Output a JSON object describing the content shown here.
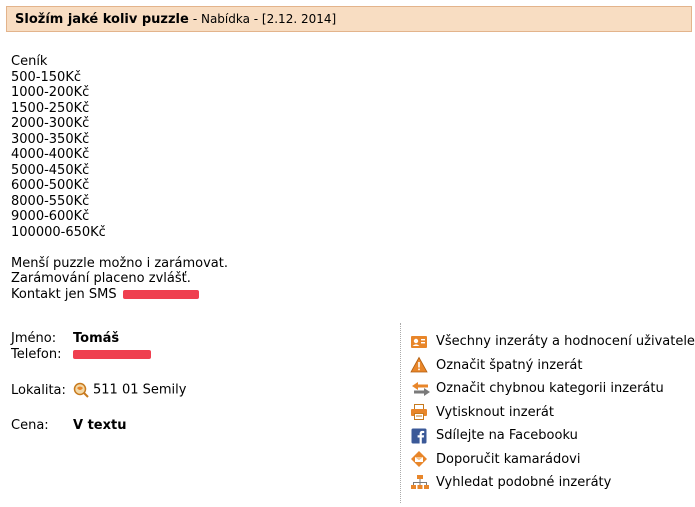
{
  "header": {
    "title": "Složím jaké koliv puzzle",
    "meta": "- Nabídka - [2.12. 2014]"
  },
  "description": {
    "pricelist_title": "Ceník",
    "prices": [
      "500-150Kč",
      "1000-200Kč",
      "1500-250Kč",
      "2000-300Kč",
      "3000-350Kč",
      "4000-400Kč",
      "5000-450Kč",
      "6000-500Kč",
      "8000-550Kč",
      "9000-600Kč",
      "100000-650Kč"
    ],
    "notes": [
      "Menší puzzle možno i zarámovat.",
      "Zarámování placeno zvlášť."
    ],
    "contact_label": "Kontakt jen SMS"
  },
  "seller": {
    "name_label": "Jméno:",
    "name_value": "Tomáš",
    "phone_label": "Telefon:",
    "location_label": "Lokalita:",
    "location_value": "511 01 Semily",
    "price_label": "Cena:",
    "price_value": "V textu"
  },
  "actions": [
    {
      "label": "Všechny inzeráty a hodnocení uživatele",
      "icon": "user-card-icon"
    },
    {
      "label": "Označit špatný inzerát",
      "icon": "warning-icon"
    },
    {
      "label": "Označit chybnou kategorii inzerátu",
      "icon": "swap-arrows-icon"
    },
    {
      "label": "Vytisknout inzerát",
      "icon": "printer-icon"
    },
    {
      "label": "Sdílejte na Facebooku",
      "icon": "facebook-icon"
    },
    {
      "label": "Doporučit kamarádovi",
      "icon": "recommend-icon"
    },
    {
      "label": "Vyhledat podobné inzeráty",
      "icon": "sitemap-icon"
    }
  ],
  "colors": {
    "header_bg": "#f8ddc2",
    "header_border": "#e3b48c",
    "redaction": "#ef3f4f",
    "icon_orange": "#e8862a"
  }
}
